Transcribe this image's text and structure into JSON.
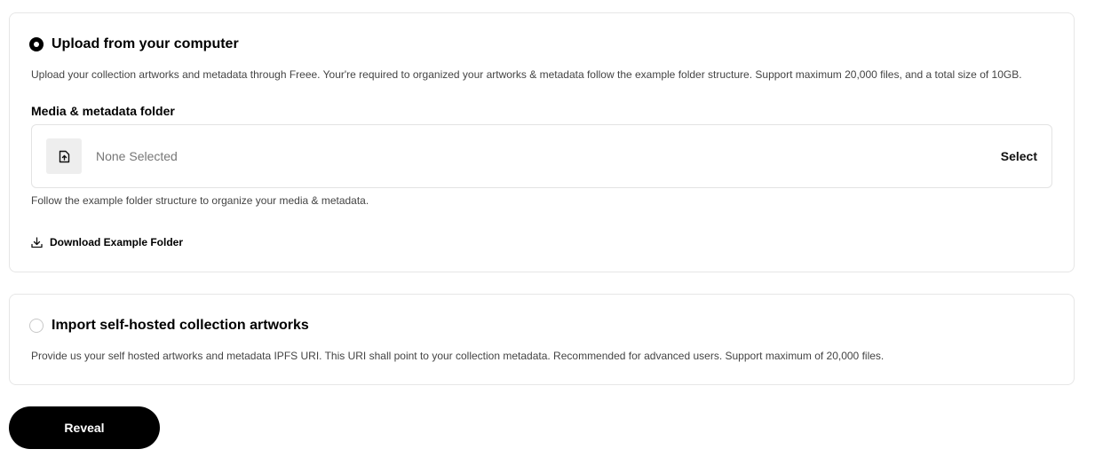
{
  "upload_option": {
    "selected": true,
    "title": "Upload from your computer",
    "description": "Upload your collection artworks and metadata through Freee. Your're required to organized your artworks & metadata follow the example folder structure. Support maximum 20,000 files, and a total size of 10GB.",
    "field_label": "Media & metadata folder",
    "file_value": "None Selected",
    "select_label": "Select",
    "help_text": "Follow the example folder structure to organize your media & metadata.",
    "download_label": "Download Example Folder",
    "icons": {
      "file": "file-upload-icon",
      "download": "download-icon"
    }
  },
  "import_option": {
    "selected": false,
    "title": "Import self-hosted collection artworks",
    "description": "Provide us your self hosted artworks and metadata IPFS URI. This URI shall point to your collection metadata. Recommended for advanced users. Support maximum of 20,000 files."
  },
  "reveal_label": "Reveal",
  "colors": {
    "primary": "#000000",
    "border": "#e6e6e6",
    "muted_text": "#777777"
  }
}
